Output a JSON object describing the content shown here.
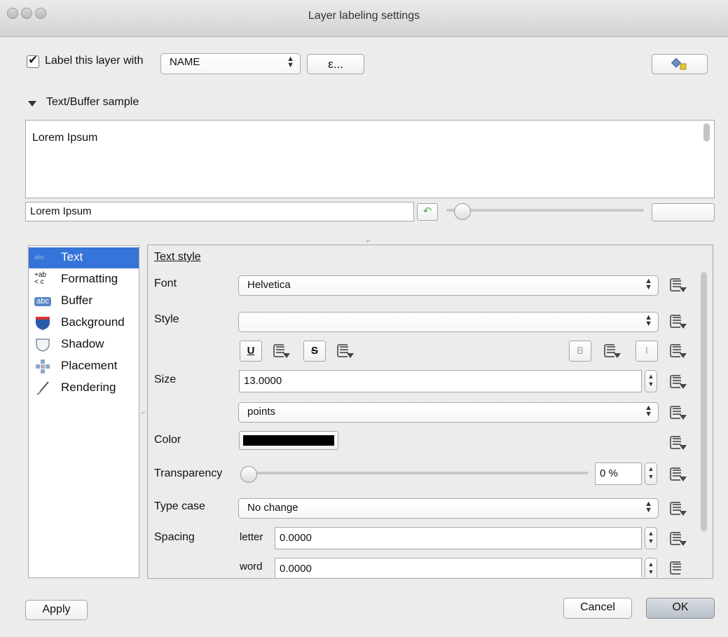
{
  "window": {
    "title": "Layer labeling settings"
  },
  "top": {
    "label_checkbox_text": "Label this layer with",
    "field_value": "NAME",
    "expression_button": "ε..."
  },
  "sample": {
    "section_title": "Text/Buffer sample",
    "preview_text": "Lorem Ipsum",
    "input_value": "Lorem Ipsum"
  },
  "sidebar": {
    "items": [
      {
        "label": "Text",
        "icon": "text-icon"
      },
      {
        "label": "Formatting",
        "icon": "formatting-icon"
      },
      {
        "label": "Buffer",
        "icon": "buffer-icon"
      },
      {
        "label": "Background",
        "icon": "background-shield-icon"
      },
      {
        "label": "Shadow",
        "icon": "shadow-icon"
      },
      {
        "label": "Placement",
        "icon": "placement-icon"
      },
      {
        "label": "Rendering",
        "icon": "rendering-brush-icon"
      }
    ]
  },
  "text_style": {
    "heading": "Text style",
    "font_label": "Font",
    "font_value": "Helvetica",
    "style_label": "Style",
    "style_value": "",
    "underline_label": "U",
    "strike_label": "S",
    "bold_label": "B",
    "italic_label": "I",
    "size_label": "Size",
    "size_value": "13.0000",
    "size_unit_value": "points",
    "color_label": "Color",
    "color_value": "#000000",
    "transparency_label": "Transparency",
    "transparency_value": "0 %",
    "transparency_level": 0,
    "type_case_label": "Type case",
    "type_case_value": "No change",
    "spacing_label": "Spacing",
    "letter_label": "letter",
    "letter_value": "0.0000",
    "word_label": "word",
    "word_value": "0.0000"
  },
  "footer": {
    "apply": "Apply",
    "cancel": "Cancel",
    "ok": "OK"
  },
  "colors": {
    "selection": "#3574d8",
    "undo_green": "#4caf50"
  }
}
